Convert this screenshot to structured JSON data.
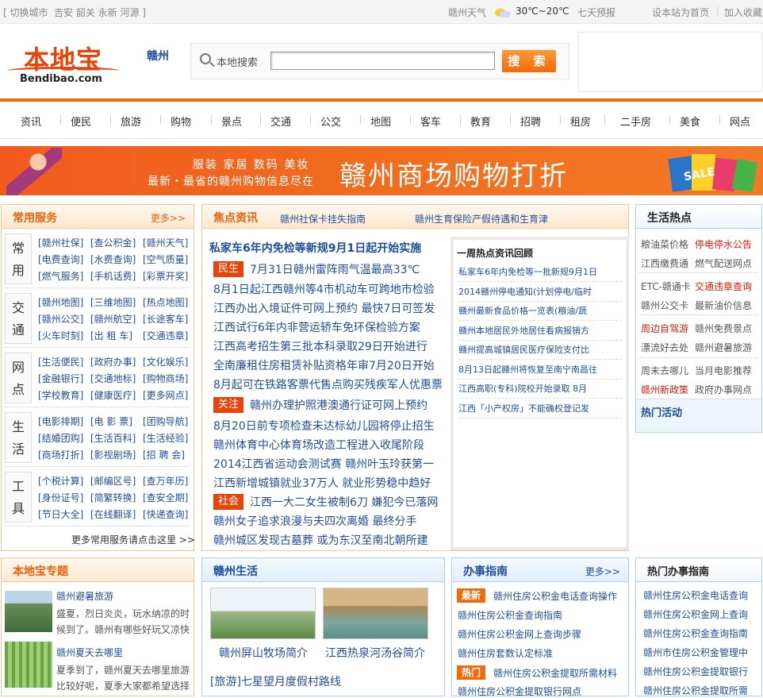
{
  "topbar": {
    "switch_city": "[ 切换城市",
    "nearby": "吉安 韶关 永新 河源 ]",
    "weather_label": "赣州天气",
    "temp": "30℃~20℃",
    "forecast": "七天预报",
    "set_home": "设本站为首页",
    "divider": "|",
    "favorite": "加入收藏"
  },
  "header": {
    "logo_cn": "本地宝",
    "logo_en": "Bendibao.com",
    "city": "赣州",
    "search_label": "本地搜索",
    "search_value": "",
    "search_button": "搜 索"
  },
  "nav": [
    "资讯",
    "便民",
    "旅游",
    "购物",
    "景点",
    "交通",
    "公交",
    "地图",
    "客车",
    "教育",
    "招聘",
    "租房",
    "二手房",
    "美食",
    "网点"
  ],
  "banner": {
    "line1": "服装  家居  数码  美妆",
    "line2": "最新・最省的赣州购物信息尽在",
    "big": "赣州商场购物打折",
    "sale": "SALE"
  },
  "services": {
    "title": "常用服务",
    "more": "更多>>",
    "groups": [
      {
        "name": "常用",
        "items": [
          "[赣州社保]",
          "[查公积金]",
          "[赣州天气]",
          "[电费查询]",
          "[水费查询]",
          "[空气质量]",
          "[燃气服务]",
          "[手机话费]",
          "[彩票开奖]"
        ]
      },
      {
        "name": "交通",
        "items": [
          "[赣州地图]",
          "[三维地图]",
          "[热点地图]",
          "[赣州公交]",
          "[赣州航空]",
          "[长途客车]",
          "[火车时刻]",
          "[出 租 车]",
          "[交通违章]"
        ]
      },
      {
        "name": "网点",
        "items": [
          "[生活便民]",
          "[政府办事]",
          "[文化娱乐]",
          "[金融银行]",
          "[交通地标]",
          "[购物商场]",
          "[学校教育]",
          "[健康医疗]",
          "[更多网点]"
        ]
      },
      {
        "name": "生活",
        "items": [
          "[电影排期]",
          "[电 影 票]",
          "[团购导航]",
          "[结婚团购]",
          "[生活百科]",
          "[生活经验]",
          "[商场打折]",
          "[影视剧场]",
          "[招 聘 会]"
        ]
      },
      {
        "name": "工具",
        "items": [
          "[个税计算]",
          "[邮编区号]",
          "[查万年历]",
          "[身份证号]",
          "[简繁转换]",
          "[查安全期]",
          "[节日大全]",
          "[在线翻译]",
          "[快递查询]"
        ]
      }
    ],
    "footer": "更多常用服务请点击这里  >>"
  },
  "focus": {
    "title": "焦点资讯",
    "links": [
      "赣州社保卡挂失指南",
      "赣州生育保险产假待遇和生育津"
    ],
    "headline": "私家车6年内免检等新规9月1日起开始实施",
    "tags": [
      "民生",
      "关注",
      "社会"
    ],
    "news": [
      "7月31日赣州雷阵雨气温最高33℃",
      "8月1日起江西赣州等4市机动车可跨地市检验",
      "江西办出入境证件可网上预约 最快7日可签发",
      "江西试行6年内非营运轿车免环保检验方案",
      "江西高考招生第三批本科录取29日开始进行",
      "全南廉租住房租赁补贴资格年审7月20日开始",
      "8月起可在铁路客票代售点购买残疾军人优惠票",
      "赣州办理护照港澳通行证可网上预约",
      "8月20日前专项检查未达标幼儿园将停止招生",
      "赣州体育中心体育场改造工程进入收尾阶段",
      "2014江西省运动会测试赛 赣州叶玉玲获第一",
      "江西新增城镇就业37万人 就业形势稳中趋好",
      "江西一大二女生被制6刀 嫌犯今已落网",
      "赣州女子追求浪漫与夫四次离婚 最终分手",
      "赣州城区发现古墓葬 或为东汉至南北朝所建"
    ],
    "hot_title": "一周热点资讯回顾",
    "hot": [
      "私家车6年内免检等一批新规9月1日",
      "2014赣州停电通知(计划停电/临时",
      "赣州最新食品价格一览表(粮油/蔬",
      "赣州本地居民外地居住看病报销方",
      "赣州提高城镇居民医疗保险支付比",
      "8月13日起赣州将恢复至南宁南昌往",
      "江西高职(专科)院校开始录取 8月",
      "江西「小产权房」不能确权登记发"
    ]
  },
  "life_hot": {
    "title": "生活热点",
    "items": [
      "粮油菜价格",
      "停电停水公告",
      "江西缴费通",
      "燃气配送网点",
      "ETC-赣通卡",
      "交通违章查询",
      "赣州公交卡",
      "最新油价信息",
      "周边自驾游",
      "赣州免费景点",
      "漂流好去处",
      "赣州避暑旅游",
      "周末去哪儿",
      "当月电影推荐",
      "赣州新政策",
      "政府办事网点"
    ],
    "activity": "热门活动"
  },
  "topics": {
    "title": "本地宝专题",
    "items": [
      {
        "title": "赣州避暑旅游",
        "desc": "盛夏，烈日炎炎，玩水纳凉的时候到了。赣州有哪些好玩又凉快"
      },
      {
        "title": "赣州夏天去哪里",
        "desc": "夏季到了，赣州夏天去哪里旅游比较好呢，夏季大家都希望选择"
      }
    ]
  },
  "ganzhou_life": {
    "title": "赣州生活",
    "pics": [
      "赣州屏山牧场简介",
      "江西热泉河汤谷简介"
    ],
    "link": "[旅游]七星望月度假村路线"
  },
  "guide": {
    "title": "办事指南",
    "more": "更多>>",
    "badges": [
      "最新",
      "热门"
    ],
    "items": [
      "赣州住房公积金电话查询操作",
      "赣州住房公积金查询指南",
      "赣州住房公积金网上查询步骤",
      "赣州住房套数认定标准",
      "赣州住房公积金提取所需材料",
      "赣州住房公积金提取银行网点"
    ]
  },
  "hot_guide": {
    "title": "热门办事指南",
    "items": [
      "赣州住房公积金电话查询",
      "赣州住房公积金网上查询",
      "赣州住房公积金查询指南",
      "赣州市住房公积金管理中",
      "赣州住房公积金提取银行",
      "赣州住房公积金提取所需"
    ]
  },
  "colors": {
    "orange": "#f06a0c",
    "blue": "#1f4e9b",
    "red": "#e8430a"
  }
}
